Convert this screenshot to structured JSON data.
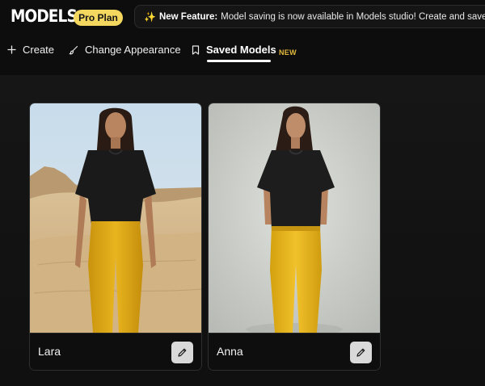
{
  "brand": {
    "logo_text": "MODELS",
    "plan_badge": "Pro Plan"
  },
  "announcement": {
    "icon": "sparkles-icon",
    "title": "New Feature:",
    "message": "Model saving is now available in Models studio! Create and save your"
  },
  "nav": {
    "items": [
      {
        "label": "Create",
        "icon": "plus-icon"
      },
      {
        "label": "Change Appearance",
        "icon": "brush-icon"
      },
      {
        "label": "Saved Models",
        "icon": "bookmark-icon",
        "active": true,
        "tag": "NEW"
      }
    ]
  },
  "models": [
    {
      "name": "Lara",
      "photo": "woman in black t-shirt and yellow pants in desert",
      "action_icon": "pencil-icon"
    },
    {
      "name": "Anna",
      "photo": "woman in black t-shirt and yellow jeans in studio",
      "action_icon": "pencil-icon"
    }
  ],
  "colors": {
    "background": "#0d0d0d",
    "plan_badge": "#f3d75f",
    "new_tag": "#e3b83b",
    "edit_button": "#d9d9d9"
  }
}
